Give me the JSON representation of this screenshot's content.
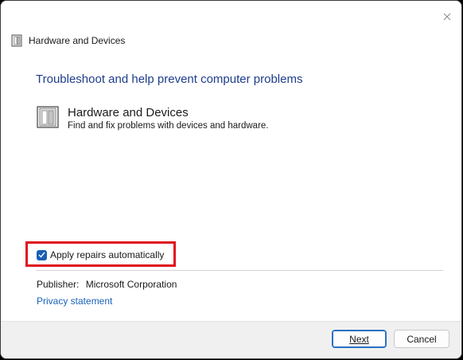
{
  "window": {
    "title": "Hardware and Devices",
    "title_icon": "hardware-devices-icon",
    "close_icon": "close-icon"
  },
  "main": {
    "heading": "Troubleshoot and help prevent computer problems",
    "item": {
      "name": "Hardware and Devices",
      "description": "Find and fix problems with devices and hardware.",
      "icon": "hardware-devices-icon"
    },
    "apply_repairs": {
      "label": "Apply repairs automatically",
      "checked": true
    },
    "publisher": {
      "label": "Publisher:",
      "value": "Microsoft Corporation"
    },
    "privacy_link": "Privacy statement"
  },
  "footer": {
    "next_label": "Next",
    "cancel_label": "Cancel"
  },
  "colors": {
    "heading": "#1e3c8c",
    "link": "#1a62b8",
    "checkbox": "#1b5fb4",
    "highlight": "#e0121e",
    "footer_bg": "#f0f0f0"
  }
}
